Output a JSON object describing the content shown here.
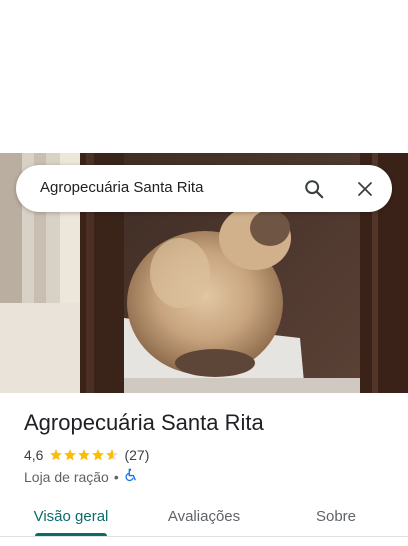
{
  "search": {
    "query": "Agropecuária Santa Rita",
    "search_icon": "search-icon",
    "close_icon": "close-icon"
  },
  "photo": {
    "icon": "place-photo"
  },
  "place": {
    "name": "Agropecuária Santa Rita",
    "rating": "4,6",
    "rating_value": 4.6,
    "stars_max": 5,
    "review_count": "(27)",
    "category": "Loja de ração",
    "separator": "•",
    "accessibility_icon": "wheelchair-accessible-icon"
  },
  "tabs": [
    {
      "label": "Visão geral",
      "active": true
    },
    {
      "label": "Avaliações",
      "active": false
    },
    {
      "label": "Sobre",
      "active": false
    }
  ],
  "colors": {
    "star": "#fbbc04",
    "accent": "#0b6b6b",
    "accessibility": "#1a73e8"
  }
}
